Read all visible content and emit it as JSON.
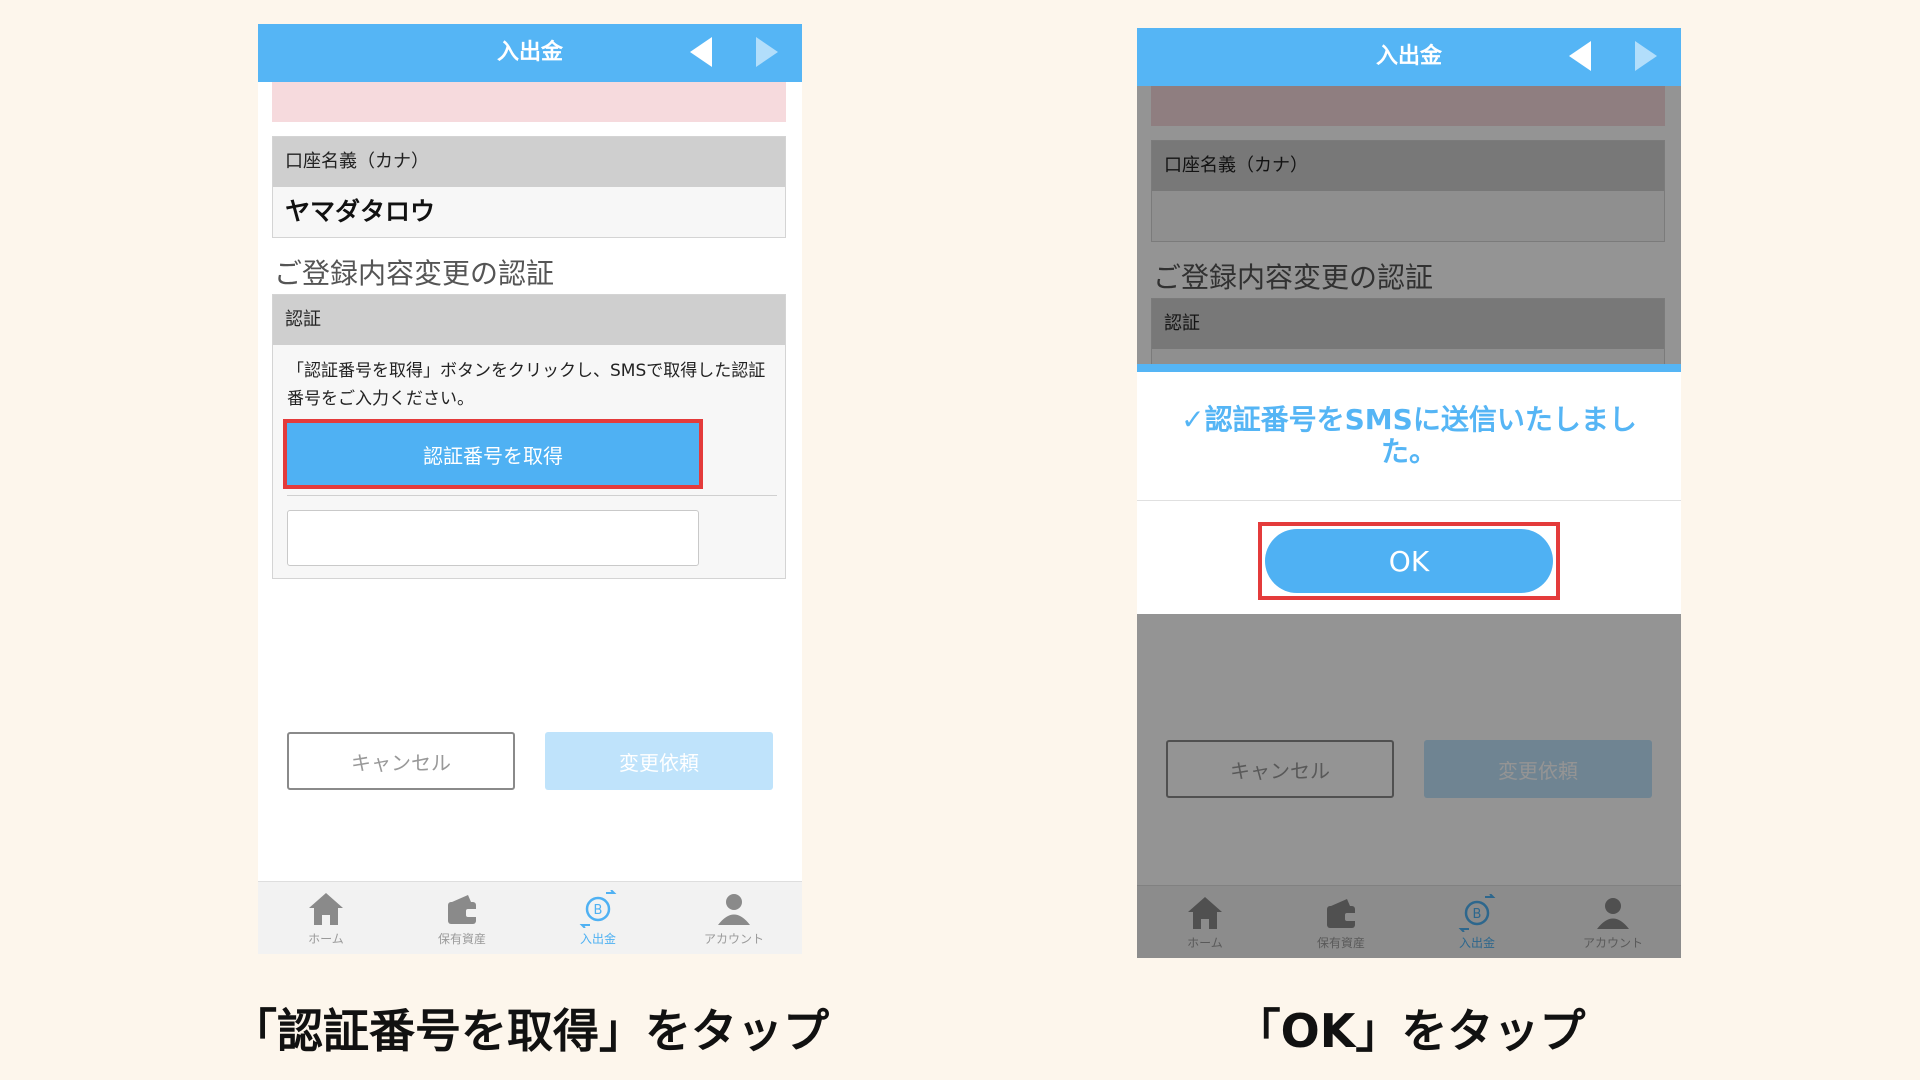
{
  "colors": {
    "accent": "#55b5f5",
    "highlight": "#e43b3b",
    "background": "#fdf6ec"
  },
  "left_screen": {
    "header": {
      "title": "入出金",
      "prev_icon": "triangle-left-icon",
      "next_icon": "triangle-right-icon"
    },
    "account_name": {
      "label": "口座名義（カナ）",
      "value": "ヤマダタロウ"
    },
    "section_title": "ご登録内容変更の認証",
    "auth": {
      "label": "認証",
      "description": "「認証番号を取得」ボタンをクリックし、SMSで取得した認証番号をご入力ください。",
      "get_code_button": "認証番号を取得",
      "code_value": ""
    },
    "buttons": {
      "cancel": "キャンセル",
      "submit": "変更依頼"
    },
    "tabs": [
      {
        "label": "ホーム",
        "icon": "home-icon",
        "active": false
      },
      {
        "label": "保有資産",
        "icon": "wallet-icon",
        "active": false
      },
      {
        "label": "入出金",
        "icon": "bitcoin-transfer-icon",
        "active": true
      },
      {
        "label": "アカウント",
        "icon": "user-icon",
        "active": false
      }
    ]
  },
  "right_screen": {
    "header": {
      "title": "入出金"
    },
    "account_name": {
      "label": "口座名義（カナ）"
    },
    "section_title": "ご登録内容変更の認証",
    "auth_label_partial": "認証",
    "dialog": {
      "message": "✓認証番号をSMSに送信いたしました。",
      "ok_button": "OK"
    },
    "buttons": {
      "cancel": "キャンセル",
      "submit": "変更依頼"
    },
    "tabs": [
      {
        "label": "ホーム"
      },
      {
        "label": "保有資産"
      },
      {
        "label": "入出金"
      },
      {
        "label": "アカウント"
      }
    ]
  },
  "captions": {
    "left": "「認証番号を取得」をタップ",
    "right": "「OK」をタップ"
  }
}
